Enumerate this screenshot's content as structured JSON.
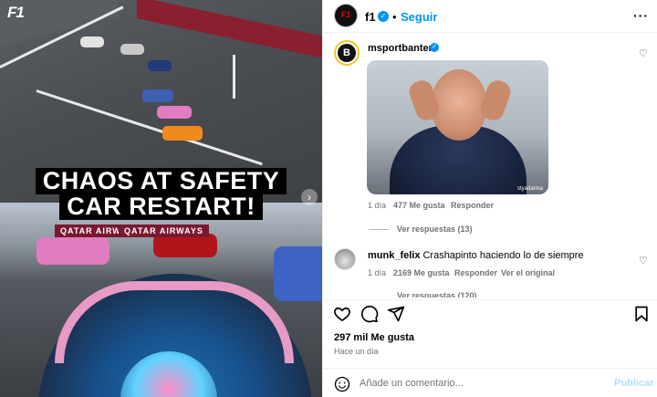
{
  "media": {
    "logo_text": "F1",
    "headline_line1": "CHAOS AT SAFETY",
    "headline_line2": "CAR RESTART!",
    "ad_top": "QATAR AIRWAYS",
    "ad_bottom": "QATAR AIRWAYS",
    "next_icon": "chevron-right-icon"
  },
  "header": {
    "username": "f1",
    "verified_icon": "verified-badge-icon",
    "separator": "•",
    "follow_label": "Seguir",
    "more_label": "···"
  },
  "comments": [
    {
      "username": "msportbanter",
      "avatar_letter": "B",
      "verified": true,
      "gif_watermark": "styadarma",
      "time": "1 día",
      "likes": "477 Me gusta",
      "reply_label": "Responder",
      "view_replies": "Ver respuestas (13)"
    },
    {
      "username": "munk_felix",
      "text": "Crashapinto haciendo lo de siempre",
      "time": "1 día",
      "likes": "2169 Me gusta",
      "reply_label": "Responder",
      "view_original": "Ver el original",
      "view_replies": "Ver respuestas (120)"
    }
  ],
  "post": {
    "likes": "297 mil Me gusta",
    "time": "Hace un día"
  },
  "composer": {
    "placeholder": "Añade un comentario...",
    "publish_label": "Publicar"
  },
  "colors": {
    "link_blue": "#0095f6",
    "publish_disabled": "#b2dffc",
    "muted_text": "#737373"
  }
}
